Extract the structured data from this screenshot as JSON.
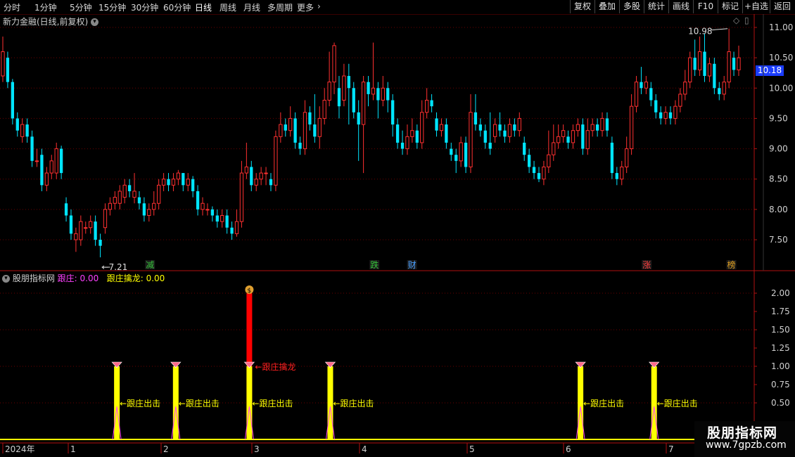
{
  "toolbar": {
    "tabs": [
      "分时",
      "1分钟",
      "5分钟",
      "15分钟",
      "30分钟",
      "60分钟",
      "日线",
      "周线",
      "月线",
      "多周期",
      "更多"
    ],
    "active_tab": "日线",
    "right_buttons": [
      "复权",
      "叠加",
      "多股",
      "统计",
      "画线",
      "F10",
      "标记",
      "+自选",
      "返回"
    ]
  },
  "main_chart": {
    "title": "新力金融(日线,前复权)",
    "high_label": "10.98",
    "low_label": "7.21",
    "current_price": "10.18",
    "y_ticks": [
      "11.00",
      "10.50",
      "10.00",
      "9.50",
      "9.00",
      "8.50",
      "8.00",
      "7.50"
    ],
    "event_markers": [
      {
        "text": "减",
        "color": "#36c23a"
      },
      {
        "text": "跌",
        "color": "#36c23a"
      },
      {
        "text": "财",
        "color": "#4aa0ff"
      },
      {
        "text": "涨",
        "color": "#ff4040"
      },
      {
        "text": "榜",
        "color": "#e0a020"
      }
    ]
  },
  "indicator": {
    "name": "股朋指标网",
    "line1_name": "跟庄:",
    "line1_value": "0.00",
    "line2_name": "跟庄擒龙:",
    "line2_value": "0.00",
    "y_ticks": [
      "2.00",
      "1.75",
      "1.50",
      "1.25",
      "1.00",
      "0.75",
      "0.50"
    ],
    "signal_label": "跟庄出击",
    "dragon_label": "跟庄擒龙",
    "signals": [
      "跟庄出击",
      "跟庄出击",
      "跟庄出击",
      "跟庄出击",
      "跟庄出击",
      "跟庄出击"
    ]
  },
  "x_axis": {
    "labels": [
      "2024年",
      "1",
      "2",
      "3",
      "4",
      "5",
      "6",
      "7"
    ]
  },
  "watermark": {
    "line1": "股朋指标网",
    "line2": "www.7gpzb.com"
  },
  "colors": {
    "up": "#ff3030",
    "down": "#00e5ff",
    "axis": "#b01010",
    "signal_bar": "#ffff00",
    "dragon_bar": "#ff0000",
    "line1": "#ff40ff",
    "line2": "#ffff00"
  },
  "chart_data": {
    "type": "candlestick",
    "ylim": [
      7.2,
      11.1
    ],
    "candles": [
      {
        "o": 10.2,
        "c": 10.6,
        "h": 10.85,
        "l": 10.1
      },
      {
        "o": 10.5,
        "c": 10.1,
        "h": 10.6,
        "l": 10.0
      },
      {
        "o": 10.1,
        "c": 9.5,
        "h": 10.15,
        "l": 9.4
      },
      {
        "o": 9.5,
        "c": 9.3,
        "h": 9.6,
        "l": 9.2
      },
      {
        "o": 9.2,
        "c": 9.4,
        "h": 9.5,
        "l": 9.1
      },
      {
        "o": 9.4,
        "c": 9.2,
        "h": 9.5,
        "l": 9.1
      },
      {
        "o": 9.2,
        "c": 8.8,
        "h": 9.3,
        "l": 8.7
      },
      {
        "o": 8.8,
        "c": 8.8,
        "h": 9.0,
        "l": 8.7
      },
      {
        "o": 8.9,
        "c": 8.4,
        "h": 9.0,
        "l": 8.3
      },
      {
        "o": 8.4,
        "c": 8.6,
        "h": 8.7,
        "l": 8.3
      },
      {
        "o": 8.6,
        "c": 8.8,
        "h": 8.9,
        "l": 8.5
      },
      {
        "o": 8.6,
        "c": 9.0,
        "h": 9.1,
        "l": 8.5
      },
      {
        "o": 9.0,
        "c": 8.6,
        "h": 9.05,
        "l": 8.5
      },
      {
        "o": 8.1,
        "c": 7.9,
        "h": 8.2,
        "l": 7.8
      },
      {
        "o": 7.9,
        "c": 7.6,
        "h": 8.0,
        "l": 7.5
      },
      {
        "o": 7.5,
        "c": 7.6,
        "h": 7.7,
        "l": 7.3
      },
      {
        "o": 7.5,
        "c": 7.8,
        "h": 7.9,
        "l": 7.4
      },
      {
        "o": 7.7,
        "c": 7.7,
        "h": 7.8,
        "l": 7.6
      },
      {
        "o": 7.7,
        "c": 7.8,
        "h": 7.9,
        "l": 7.6
      },
      {
        "o": 7.8,
        "c": 7.5,
        "h": 7.9,
        "l": 7.4
      },
      {
        "o": 7.5,
        "c": 7.4,
        "h": 7.6,
        "l": 7.21
      },
      {
        "o": 7.7,
        "c": 8.0,
        "h": 8.1,
        "l": 7.6
      },
      {
        "o": 8.0,
        "c": 8.1,
        "h": 8.2,
        "l": 7.9
      },
      {
        "o": 8.1,
        "c": 8.2,
        "h": 8.3,
        "l": 8.0
      },
      {
        "o": 8.1,
        "c": 8.3,
        "h": 8.4,
        "l": 8.0
      },
      {
        "o": 8.2,
        "c": 8.4,
        "h": 8.5,
        "l": 8.1
      },
      {
        "o": 8.4,
        "c": 8.3,
        "h": 8.5,
        "l": 8.2
      },
      {
        "o": 8.2,
        "c": 8.3,
        "h": 8.6,
        "l": 8.1
      },
      {
        "o": 8.2,
        "c": 8.1,
        "h": 8.3,
        "l": 8.0
      },
      {
        "o": 8.1,
        "c": 7.9,
        "h": 8.2,
        "l": 7.8
      },
      {
        "o": 7.9,
        "c": 8.0,
        "h": 8.1,
        "l": 7.8
      },
      {
        "o": 8.0,
        "c": 8.1,
        "h": 8.3,
        "l": 7.9
      },
      {
        "o": 8.1,
        "c": 8.4,
        "h": 8.5,
        "l": 8.0
      },
      {
        "o": 8.4,
        "c": 8.5,
        "h": 8.6,
        "l": 8.3
      },
      {
        "o": 8.5,
        "c": 8.4,
        "h": 8.6,
        "l": 8.3
      },
      {
        "o": 8.4,
        "c": 8.5,
        "h": 8.6,
        "l": 8.3
      },
      {
        "o": 8.5,
        "c": 8.6,
        "h": 8.65,
        "l": 8.4
      },
      {
        "o": 8.6,
        "c": 8.4,
        "h": 8.6,
        "l": 8.3
      },
      {
        "o": 8.4,
        "c": 8.5,
        "h": 8.6,
        "l": 8.3
      },
      {
        "o": 8.5,
        "c": 8.3,
        "h": 8.55,
        "l": 8.2
      },
      {
        "o": 8.3,
        "c": 8.0,
        "h": 8.4,
        "l": 7.9
      },
      {
        "o": 8.0,
        "c": 8.1,
        "h": 8.2,
        "l": 7.9
      },
      {
        "o": 8.0,
        "c": 8.0,
        "h": 8.1,
        "l": 7.9
      },
      {
        "o": 8.0,
        "c": 7.9,
        "h": 8.05,
        "l": 7.8
      },
      {
        "o": 7.9,
        "c": 7.8,
        "h": 8.0,
        "l": 7.7
      },
      {
        "o": 7.8,
        "c": 7.9,
        "h": 8.0,
        "l": 7.7
      },
      {
        "o": 7.9,
        "c": 7.7,
        "h": 8.0,
        "l": 7.6
      },
      {
        "o": 7.7,
        "c": 7.6,
        "h": 7.8,
        "l": 7.5
      },
      {
        "o": 7.6,
        "c": 7.8,
        "h": 8.0,
        "l": 7.55
      },
      {
        "o": 7.8,
        "c": 8.6,
        "h": 8.8,
        "l": 7.7
      },
      {
        "o": 8.6,
        "c": 8.7,
        "h": 9.1,
        "l": 8.5
      },
      {
        "o": 8.7,
        "c": 8.4,
        "h": 8.8,
        "l": 8.3
      },
      {
        "o": 8.4,
        "c": 8.5,
        "h": 8.6,
        "l": 8.3
      },
      {
        "o": 8.5,
        "c": 8.6,
        "h": 8.7,
        "l": 8.4
      },
      {
        "o": 8.6,
        "c": 8.6,
        "h": 8.7,
        "l": 8.4
      },
      {
        "o": 8.5,
        "c": 8.4,
        "h": 8.6,
        "l": 8.3
      },
      {
        "o": 8.4,
        "c": 9.2,
        "h": 9.3,
        "l": 8.3
      },
      {
        "o": 9.2,
        "c": 9.4,
        "h": 9.6,
        "l": 9.1
      },
      {
        "o": 9.4,
        "c": 9.3,
        "h": 9.5,
        "l": 9.2
      },
      {
        "o": 9.3,
        "c": 9.5,
        "h": 9.7,
        "l": 9.2
      },
      {
        "o": 9.5,
        "c": 9.1,
        "h": 9.6,
        "l": 9.0
      },
      {
        "o": 9.1,
        "c": 9.0,
        "h": 9.2,
        "l": 8.9
      },
      {
        "o": 9.0,
        "c": 9.6,
        "h": 9.8,
        "l": 8.9
      },
      {
        "o": 9.6,
        "c": 9.4,
        "h": 9.7,
        "l": 9.3
      },
      {
        "o": 9.4,
        "c": 9.2,
        "h": 9.9,
        "l": 9.1
      },
      {
        "o": 9.2,
        "c": 9.5,
        "h": 9.7,
        "l": 9.0
      },
      {
        "o": 9.5,
        "c": 9.8,
        "h": 10.0,
        "l": 9.4
      },
      {
        "o": 9.8,
        "c": 10.1,
        "h": 10.6,
        "l": 9.7
      },
      {
        "o": 10.1,
        "c": 10.7,
        "h": 10.75,
        "l": 9.9
      },
      {
        "o": 10.0,
        "c": 9.7,
        "h": 10.2,
        "l": 9.5
      },
      {
        "o": 9.8,
        "c": 10.2,
        "h": 10.4,
        "l": 9.7
      },
      {
        "o": 10.2,
        "c": 10.0,
        "h": 10.4,
        "l": 9.4
      },
      {
        "o": 10.0,
        "c": 9.6,
        "h": 10.1,
        "l": 9.5
      },
      {
        "o": 9.6,
        "c": 9.4,
        "h": 9.8,
        "l": 8.8
      },
      {
        "o": 9.4,
        "c": 10.1,
        "h": 10.2,
        "l": 8.6
      },
      {
        "o": 10.1,
        "c": 9.9,
        "h": 10.2,
        "l": 9.7
      },
      {
        "o": 9.9,
        "c": 10.0,
        "h": 10.75,
        "l": 9.8
      },
      {
        "o": 10.0,
        "c": 9.8,
        "h": 10.1,
        "l": 9.5
      },
      {
        "o": 9.8,
        "c": 10.0,
        "h": 10.2,
        "l": 9.7
      },
      {
        "o": 10.0,
        "c": 9.8,
        "h": 10.1,
        "l": 9.6
      },
      {
        "o": 9.8,
        "c": 9.4,
        "h": 9.9,
        "l": 9.2
      },
      {
        "o": 9.4,
        "c": 9.1,
        "h": 9.5,
        "l": 9.0
      },
      {
        "o": 9.1,
        "c": 9.0,
        "h": 9.3,
        "l": 8.9
      },
      {
        "o": 9.0,
        "c": 9.2,
        "h": 9.4,
        "l": 8.9
      },
      {
        "o": 9.2,
        "c": 9.3,
        "h": 9.5,
        "l": 9.1
      },
      {
        "o": 9.3,
        "c": 9.1,
        "h": 9.4,
        "l": 9.0
      },
      {
        "o": 9.1,
        "c": 9.6,
        "h": 9.8,
        "l": 9.0
      },
      {
        "o": 9.6,
        "c": 9.8,
        "h": 10.0,
        "l": 9.5
      },
      {
        "o": 9.8,
        "c": 9.7,
        "h": 9.9,
        "l": 9.6
      },
      {
        "o": 9.5,
        "c": 9.3,
        "h": 9.6,
        "l": 9.2
      },
      {
        "o": 9.3,
        "c": 9.4,
        "h": 9.5,
        "l": 9.2
      },
      {
        "o": 9.4,
        "c": 9.1,
        "h": 9.5,
        "l": 9.0
      },
      {
        "o": 9.0,
        "c": 8.9,
        "h": 9.1,
        "l": 8.8
      },
      {
        "o": 8.9,
        "c": 8.8,
        "h": 9.0,
        "l": 8.6
      },
      {
        "o": 8.8,
        "c": 9.1,
        "h": 9.2,
        "l": 8.7
      },
      {
        "o": 9.1,
        "c": 8.7,
        "h": 9.2,
        "l": 8.6
      },
      {
        "o": 8.7,
        "c": 9.6,
        "h": 9.9,
        "l": 8.6
      },
      {
        "o": 9.6,
        "c": 9.4,
        "h": 9.9,
        "l": 9.3
      },
      {
        "o": 9.4,
        "c": 9.3,
        "h": 9.5,
        "l": 9.2
      },
      {
        "o": 9.3,
        "c": 9.1,
        "h": 9.4,
        "l": 9.0
      },
      {
        "o": 9.1,
        "c": 9.0,
        "h": 9.6,
        "l": 8.9
      },
      {
        "o": 9.2,
        "c": 9.4,
        "h": 9.5,
        "l": 9.1
      },
      {
        "o": 9.4,
        "c": 9.3,
        "h": 9.6,
        "l": 9.2
      },
      {
        "o": 9.3,
        "c": 9.2,
        "h": 9.4,
        "l": 9.1
      },
      {
        "o": 9.2,
        "c": 9.4,
        "h": 9.5,
        "l": 9.1
      },
      {
        "o": 9.4,
        "c": 9.3,
        "h": 9.5,
        "l": 9.2
      },
      {
        "o": 9.3,
        "c": 9.5,
        "h": 9.6,
        "l": 9.2
      },
      {
        "o": 9.1,
        "c": 8.9,
        "h": 9.2,
        "l": 8.8
      },
      {
        "o": 8.9,
        "c": 8.7,
        "h": 9.0,
        "l": 8.6
      },
      {
        "o": 8.7,
        "c": 8.6,
        "h": 8.8,
        "l": 8.5
      },
      {
        "o": 8.6,
        "c": 8.5,
        "h": 8.7,
        "l": 8.45
      },
      {
        "o": 8.5,
        "c": 8.7,
        "h": 8.8,
        "l": 8.4
      },
      {
        "o": 8.7,
        "c": 8.9,
        "h": 9.3,
        "l": 8.6
      },
      {
        "o": 8.9,
        "c": 9.1,
        "h": 9.4,
        "l": 8.8
      },
      {
        "o": 9.1,
        "c": 9.2,
        "h": 9.4,
        "l": 9.0
      },
      {
        "o": 9.2,
        "c": 9.3,
        "h": 9.4,
        "l": 9.1
      },
      {
        "o": 9.2,
        "c": 9.1,
        "h": 9.3,
        "l": 9.0
      },
      {
        "o": 9.1,
        "c": 9.3,
        "h": 9.4,
        "l": 9.0
      },
      {
        "o": 9.3,
        "c": 9.4,
        "h": 9.5,
        "l": 9.2
      },
      {
        "o": 9.4,
        "c": 9.0,
        "h": 9.5,
        "l": 8.9
      },
      {
        "o": 9.0,
        "c": 9.3,
        "h": 9.5,
        "l": 8.9
      },
      {
        "o": 9.3,
        "c": 9.4,
        "h": 9.5,
        "l": 9.2
      },
      {
        "o": 9.4,
        "c": 9.3,
        "h": 9.5,
        "l": 9.2
      },
      {
        "o": 9.3,
        "c": 9.5,
        "h": 9.6,
        "l": 9.2
      },
      {
        "o": 9.5,
        "c": 9.3,
        "h": 9.6,
        "l": 9.2
      },
      {
        "o": 9.1,
        "c": 8.6,
        "h": 9.2,
        "l": 8.5
      },
      {
        "o": 8.6,
        "c": 8.5,
        "h": 8.7,
        "l": 8.4
      },
      {
        "o": 8.5,
        "c": 8.7,
        "h": 8.8,
        "l": 8.4
      },
      {
        "o": 8.7,
        "c": 9.0,
        "h": 9.2,
        "l": 8.6
      },
      {
        "o": 9.0,
        "c": 9.7,
        "h": 9.9,
        "l": 8.9
      },
      {
        "o": 9.7,
        "c": 10.1,
        "h": 10.2,
        "l": 9.6
      },
      {
        "o": 10.1,
        "c": 10.0,
        "h": 10.35,
        "l": 9.9
      },
      {
        "o": 10.0,
        "c": 10.1,
        "h": 10.2,
        "l": 9.9
      },
      {
        "o": 10.0,
        "c": 9.8,
        "h": 10.1,
        "l": 9.7
      },
      {
        "o": 9.8,
        "c": 9.6,
        "h": 9.9,
        "l": 9.5
      },
      {
        "o": 9.6,
        "c": 9.5,
        "h": 9.7,
        "l": 9.4
      },
      {
        "o": 9.5,
        "c": 9.6,
        "h": 9.7,
        "l": 9.4
      },
      {
        "o": 9.6,
        "c": 9.5,
        "h": 9.7,
        "l": 9.4
      },
      {
        "o": 9.5,
        "c": 9.7,
        "h": 9.8,
        "l": 9.4
      },
      {
        "o": 9.7,
        "c": 9.9,
        "h": 10.0,
        "l": 9.6
      },
      {
        "o": 9.9,
        "c": 10.1,
        "h": 10.3,
        "l": 9.8
      },
      {
        "o": 10.1,
        "c": 10.5,
        "h": 10.6,
        "l": 10.0
      },
      {
        "o": 10.5,
        "c": 10.3,
        "h": 10.8,
        "l": 10.2
      },
      {
        "o": 10.3,
        "c": 10.6,
        "h": 10.85,
        "l": 10.2
      },
      {
        "o": 10.6,
        "c": 10.2,
        "h": 10.9,
        "l": 10.1
      },
      {
        "o": 10.2,
        "c": 10.4,
        "h": 10.5,
        "l": 10.1
      },
      {
        "o": 10.4,
        "c": 10.0,
        "h": 10.5,
        "l": 9.9
      },
      {
        "o": 10.0,
        "c": 9.9,
        "h": 10.1,
        "l": 9.8
      },
      {
        "o": 9.9,
        "c": 10.1,
        "h": 10.2,
        "l": 9.8
      },
      {
        "o": 10.1,
        "c": 10.6,
        "h": 10.98,
        "l": 10.0
      },
      {
        "o": 10.5,
        "c": 10.3,
        "h": 10.6,
        "l": 10.2
      },
      {
        "o": 10.3,
        "c": 10.5,
        "h": 10.7,
        "l": 10.2
      }
    ],
    "indicator": {
      "ylim": [
        0,
        2.2
      ],
      "signal_dates": [
        0.155,
        0.235,
        0.335,
        0.445,
        0.785,
        0.885
      ],
      "signal_values": [
        1.0,
        1.0,
        1.0,
        1.0,
        1.0,
        1.0
      ],
      "dragon_date": 0.335,
      "dragon_value": 2.0
    }
  }
}
